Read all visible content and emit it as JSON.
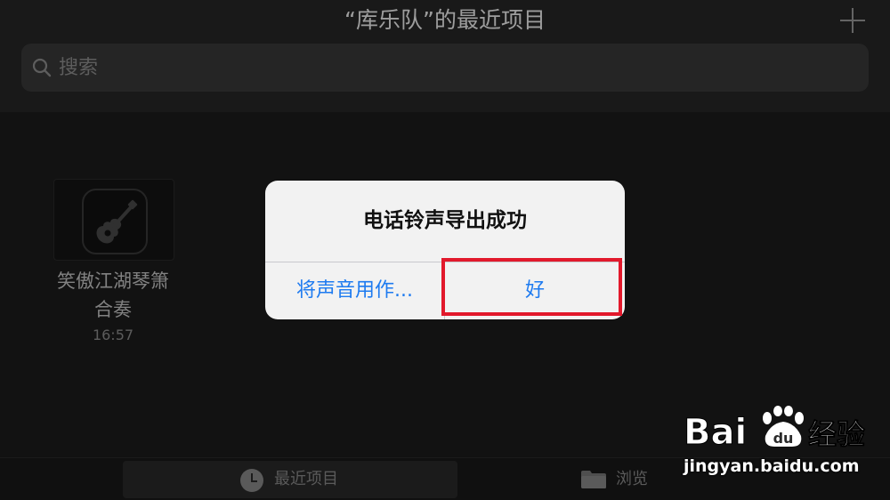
{
  "header": {
    "title": "“库乐队”的最近项目",
    "add_icon": "plus-icon"
  },
  "search": {
    "placeholder": "搜索",
    "value": "",
    "icon": "search-icon"
  },
  "projects": [
    {
      "name_line1": "笑傲江湖琴箫",
      "name_line2": "合奏",
      "time": "16:57",
      "icon": "guitar-icon"
    }
  ],
  "tabbar": {
    "recent_label": "最近项目",
    "recent_icon": "clock-icon",
    "browse_label": "浏览",
    "browse_icon": "folder-icon"
  },
  "alert": {
    "title": "电话铃声导出成功",
    "left_button": "将声音用作...",
    "right_button": "好"
  },
  "watermark": {
    "brand": "Baidu",
    "brand_suffix": "经验",
    "url": "jingyan.baidu.com"
  },
  "colors": {
    "accent": "#1e7bf0",
    "highlight": "#e2192c",
    "dialog_bg": "#f2f2f2",
    "background": "#1c1c1c"
  }
}
